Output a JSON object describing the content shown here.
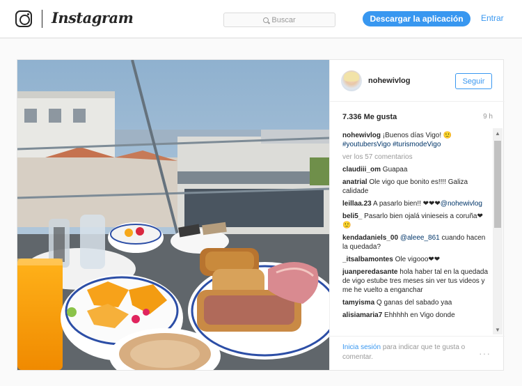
{
  "header": {
    "brand": "Instagram",
    "search_placeholder": "Buscar",
    "download_label": "Descargar la aplicación",
    "login_label": "Entrar"
  },
  "post": {
    "username": "nohewivlog",
    "follow_label": "Seguir",
    "likes": "7.336 Me gusta",
    "time_ago": "9 h",
    "caption": {
      "user": "nohewivlog",
      "text": "¡Buenos días Vigo! 🙂",
      "tags": "#youtubersVigo #turismodeVigo"
    },
    "view_more": "ver los 57 comentarios",
    "comments": [
      {
        "user": "claudiii_om",
        "text": "Guapaa"
      },
      {
        "user": "anatrial",
        "text": "Ole vigo que bonito es!!!! Galiza calidade"
      },
      {
        "user": "leillaa.23",
        "text": "A pasarlo bien!! ❤❤❤",
        "mention": "@nohewivlog"
      },
      {
        "user": "beli5_",
        "text": "Pasarlo bien ojalá vinieseis a coruña❤🙂"
      },
      {
        "user": "kendadaniels_00",
        "mention": "@aleee_861",
        "text": "cuando hacen la quedada?"
      },
      {
        "user": "_itsalbamontes",
        "text": "Ole vigooo❤❤"
      },
      {
        "user": "juanperedasante",
        "text": "hola haber tal en la quedada de vigo estube tres meses sin ver tus videos y me he vuelto a enganchar"
      },
      {
        "user": "tamyisma",
        "text": "Q ganas del sabado yaa"
      },
      {
        "user": "alisiamaria7",
        "text": "Ehhhhh en Vigo donde"
      }
    ],
    "footer": {
      "login_link": "Inicia sesión",
      "login_text": "para indicar que te gusta o comentar.",
      "more_icon": "···"
    }
  },
  "colors": {
    "accent": "#3897f0",
    "text": "#262626",
    "muted": "#999999",
    "mention": "#003569"
  }
}
